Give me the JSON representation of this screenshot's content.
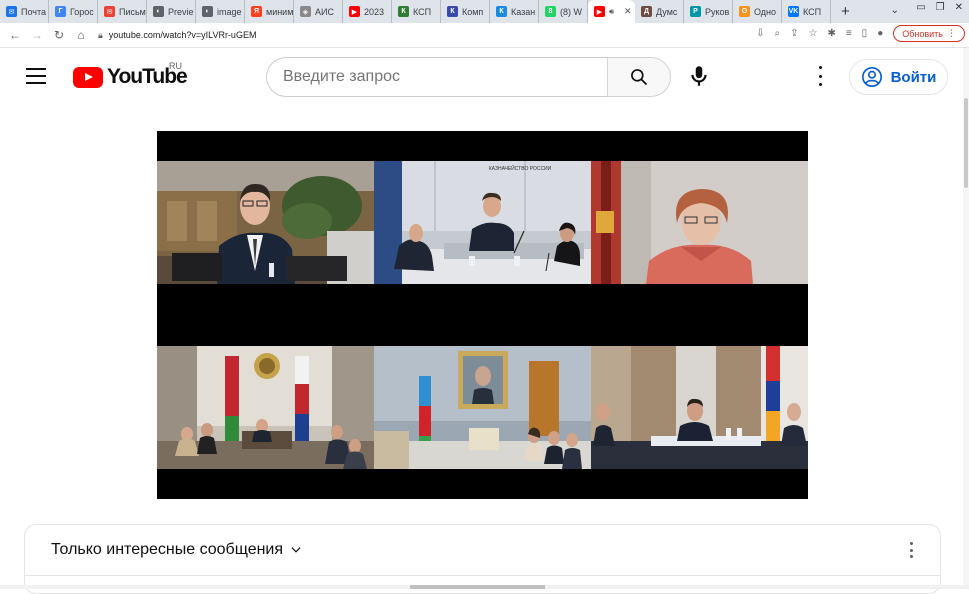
{
  "browser": {
    "tabs": [
      {
        "label": "Почта",
        "fav": "#1a73e8",
        "glyph": "✉"
      },
      {
        "label": "Горос",
        "fav": "#4285f4",
        "glyph": "Г"
      },
      {
        "label": "Письм",
        "fav": "#ea4335",
        "glyph": "✉"
      },
      {
        "label": "Previe",
        "fav": "#5f6368",
        "glyph": "◐"
      },
      {
        "label": "image",
        "fav": "#5f6368",
        "glyph": "◐"
      },
      {
        "label": "миним",
        "fav": "#fc3f1d",
        "glyph": "Я"
      },
      {
        "label": "АИС",
        "fav": "#888888",
        "glyph": "◈"
      },
      {
        "label": "2023",
        "fav": "#ff0000",
        "glyph": "▶"
      },
      {
        "label": "КСП",
        "fav": "#2e7d32",
        "glyph": "К"
      },
      {
        "label": "Комп",
        "fav": "#3949ab",
        "glyph": "К"
      },
      {
        "label": "Казан",
        "fav": "#1e88e5",
        "glyph": "К"
      },
      {
        "label": "(8) W",
        "fav": "#25d366",
        "glyph": "8"
      },
      {
        "label": "",
        "fav": "#ff0000",
        "glyph": "▶",
        "active": true
      },
      {
        "label": "Думс",
        "fav": "#6d4c41",
        "glyph": "Д"
      },
      {
        "label": "Руков",
        "fav": "#0097a7",
        "glyph": "Р"
      },
      {
        "label": "Одно",
        "fav": "#f7931e",
        "glyph": "О"
      },
      {
        "label": "КСП",
        "fav": "#0077ff",
        "glyph": "VK"
      }
    ],
    "new_tab": "+",
    "url": "youtube.com/watch?v=yILVRr-uGEM",
    "update_label": "Обновить"
  },
  "youtube": {
    "logo_text": "YouTube",
    "region": "RU",
    "search_placeholder": "Введите запрос",
    "signin_label": "Войти"
  },
  "video": {
    "tiles": [
      {
        "id": "speaker-russia-left",
        "bg": "#6b5a3c"
      },
      {
        "id": "kaznacheistvo-room",
        "bg": "#c8ccd4",
        "sign": "КАЗНАЧЕЙСТВО РОССИИ"
      },
      {
        "id": "woman-speaker",
        "bg": "#cfcac6"
      },
      {
        "id": "belarus-room",
        "bg": "#b7b1a8"
      },
      {
        "id": "azerbaijan-room",
        "bg": "#9aa8b6"
      },
      {
        "id": "armenia-room",
        "bg": "#d8d5d0"
      }
    ]
  },
  "chat": {
    "title": "Только интересные сообщения"
  }
}
